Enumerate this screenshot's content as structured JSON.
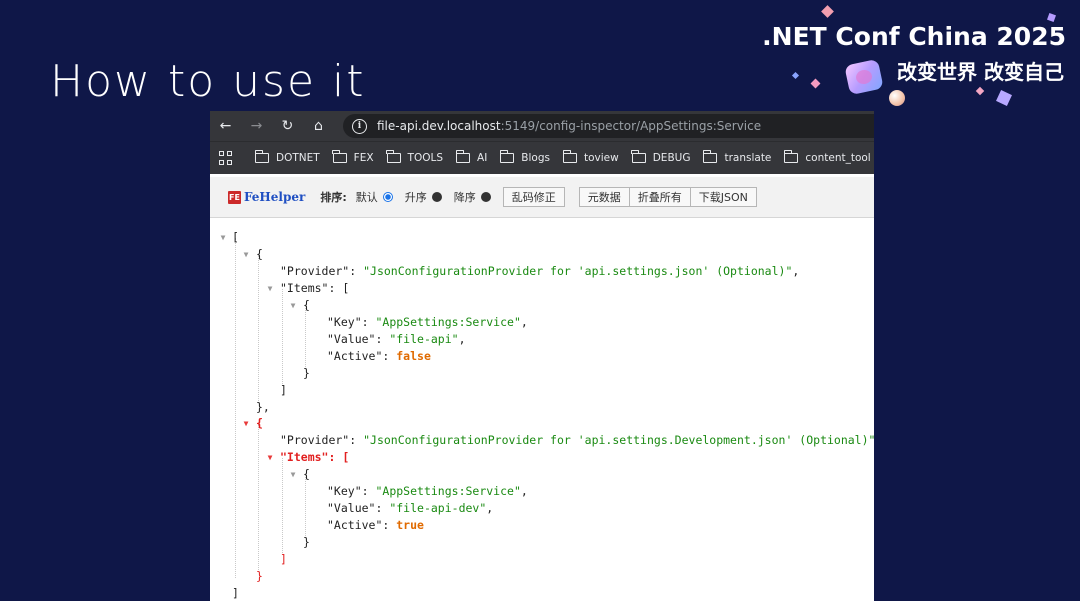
{
  "slide": {
    "title": "How to use it",
    "conference": ".NET Conf China 2025",
    "slogan": "改变世界 改变自己"
  },
  "browser": {
    "url_host": "file-api.dev.localhost",
    "url_path": ":5149/config-inspector/AppSettings:Service",
    "bookmarks": [
      "DOTNET",
      "FEX",
      "TOOLS",
      "AI",
      "Blogs",
      "toview",
      "DEBUG",
      "translate",
      "content_tool"
    ]
  },
  "fehelper": {
    "brand_badge": "FE",
    "brand_name": "FeHelper",
    "sort_label": "排序:",
    "sort_default": "默认",
    "sort_asc": "升序",
    "sort_desc": "降序",
    "fix_encoding": "乱码修正",
    "metadata": "元数据",
    "collapse_all": "折叠所有",
    "download_json": "下载JSON"
  },
  "json": {
    "open_bracket": "[",
    "close_bracket": "]",
    "open_brace": "{",
    "close_brace": "}",
    "close_brace_comma": "},",
    "items_open": "[",
    "entries": [
      {
        "provider_key": "\"Provider\"",
        "provider_value": "\"JsonConfigurationProvider for 'api.settings.json' (Optional)\"",
        "items_key": "\"Items\"",
        "item_key_key": "\"Key\"",
        "item_key_value": "\"AppSettings:Service\"",
        "item_value_key": "\"Value\"",
        "item_value_value": "\"file-api\"",
        "item_active_key": "\"Active\"",
        "item_active_value": "false"
      },
      {
        "provider_key": "\"Provider\"",
        "provider_value": "\"JsonConfigurationProvider for 'api.settings.Development.json' (Optional)\"",
        "items_key": "\"Items\"",
        "item_key_key": "\"Key\"",
        "item_key_value": "\"AppSettings:Service\"",
        "item_value_key": "\"Value\"",
        "item_value_value": "\"file-api-dev\"",
        "item_active_key": "\"Active\"",
        "item_active_value": "true"
      }
    ]
  }
}
